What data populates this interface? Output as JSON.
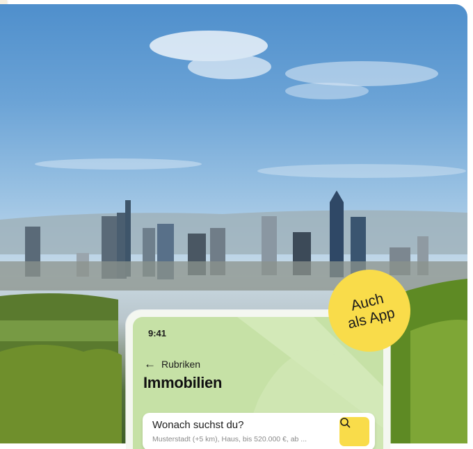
{
  "badge": {
    "line1": "Auch",
    "line2": "als App"
  },
  "phone": {
    "time": "9:41",
    "back_label": "Rubriken",
    "title": "Immobilien",
    "search": {
      "label": "Wonach suchst du?",
      "hint": "Musterstadt (+5 km), Haus, bis 520.000 €, ab ..."
    }
  },
  "icons": [
    "back-arrow-icon",
    "search-icon"
  ],
  "colors": {
    "accent_yellow": "#f9dc4a",
    "phone_green": "#c6e1a6"
  }
}
